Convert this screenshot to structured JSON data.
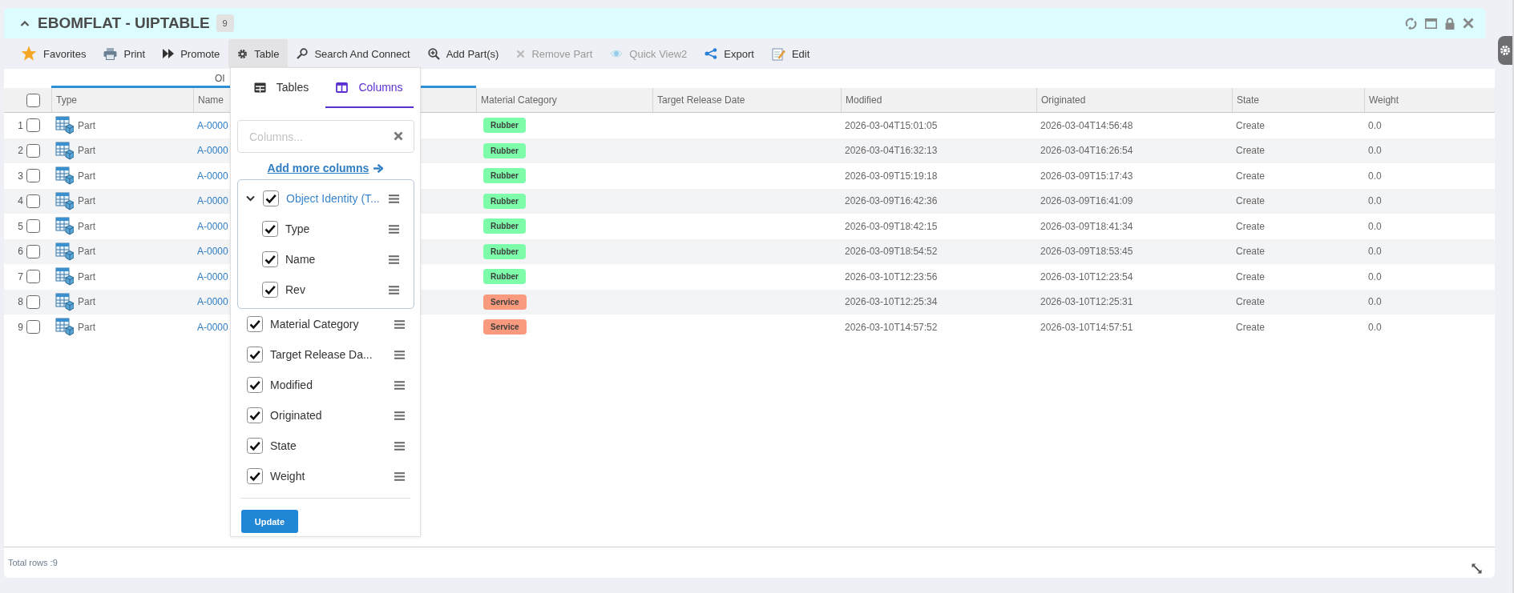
{
  "panel": {
    "title": "EBOMFLAT - UIPTABLE",
    "count": "9",
    "expanded": true
  },
  "toolbar": [
    {
      "label": "Favorites",
      "selected": false,
      "disabled": false
    },
    {
      "label": "Print",
      "selected": false,
      "disabled": false
    },
    {
      "label": "Promote",
      "selected": false,
      "disabled": false
    },
    {
      "label": "Table",
      "selected": true,
      "disabled": false
    },
    {
      "label": "Search And Connect",
      "selected": false,
      "disabled": false
    },
    {
      "label": "Add Part(s)",
      "selected": false,
      "disabled": false
    },
    {
      "label": "Remove Part",
      "selected": false,
      "disabled": true
    },
    {
      "label": "Quick View2",
      "selected": false,
      "disabled": true
    },
    {
      "label": "Export",
      "selected": false,
      "disabled": false
    },
    {
      "label": "Edit",
      "selected": false,
      "disabled": false
    }
  ],
  "table": {
    "group_header": "OI",
    "header_checked": false,
    "columns": [
      "Type",
      "Name",
      "Material Category",
      "Target Release Date",
      "Modified",
      "Originated",
      "State",
      "Weight"
    ],
    "rows": [
      {
        "number": "1",
        "checked": false,
        "type": "Part",
        "name": "A-0000",
        "material_category": {
          "label": "Rubber",
          "color": "#7dfcaa"
        },
        "modified": "2026-03-04T15:01:05",
        "originated": "2026-03-04T14:56:48",
        "state": "Create",
        "weight": "0.0"
      },
      {
        "number": "2",
        "checked": false,
        "type": "Part",
        "name": "A-0000",
        "material_category": {
          "label": "Rubber",
          "color": "#7dfcaa"
        },
        "modified": "2026-03-04T16:32:13",
        "originated": "2026-03-04T16:26:54",
        "state": "Create",
        "weight": "0.0"
      },
      {
        "number": "3",
        "checked": false,
        "type": "Part",
        "name": "A-0000",
        "material_category": {
          "label": "Rubber",
          "color": "#7dfcaa"
        },
        "modified": "2026-03-09T15:19:18",
        "originated": "2026-03-09T15:17:43",
        "state": "Create",
        "weight": "0.0"
      },
      {
        "number": "4",
        "checked": false,
        "type": "Part",
        "name": "A-0000",
        "material_category": {
          "label": "Rubber",
          "color": "#7dfcaa"
        },
        "modified": "2026-03-09T16:42:36",
        "originated": "2026-03-09T16:41:09",
        "state": "Create",
        "weight": "0.0"
      },
      {
        "number": "5",
        "checked": false,
        "type": "Part",
        "name": "A-0000",
        "material_category": {
          "label": "Rubber",
          "color": "#7dfcaa"
        },
        "modified": "2026-03-09T18:42:15",
        "originated": "2026-03-09T18:41:34",
        "state": "Create",
        "weight": "0.0"
      },
      {
        "number": "6",
        "checked": false,
        "type": "Part",
        "name": "A-0000",
        "material_category": {
          "label": "Rubber",
          "color": "#7dfcaa"
        },
        "modified": "2026-03-09T18:54:52",
        "originated": "2026-03-09T18:53:45",
        "state": "Create",
        "weight": "0.0"
      },
      {
        "number": "7",
        "checked": false,
        "type": "Part",
        "name": "A-0000",
        "material_category": {
          "label": "Rubber",
          "color": "#7dfcaa"
        },
        "modified": "2026-03-10T12:23:56",
        "originated": "2026-03-10T12:23:54",
        "state": "Create",
        "weight": "0.0"
      },
      {
        "number": "8",
        "checked": false,
        "type": "Part",
        "name": "A-0000",
        "material_category": {
          "label": "Service",
          "color": "#f99a7f"
        },
        "modified": "2026-03-10T12:25:34",
        "originated": "2026-03-10T12:25:31",
        "state": "Create",
        "weight": "0.0"
      },
      {
        "number": "9",
        "checked": false,
        "type": "Part",
        "name": "A-0000",
        "material_category": {
          "label": "Service",
          "color": "#f99a7f"
        },
        "modified": "2026-03-10T14:57:52",
        "originated": "2026-03-10T14:57:51",
        "state": "Create",
        "weight": "0.0"
      }
    ]
  },
  "column_picker": {
    "tabs": [
      {
        "label": "Tables",
        "selected": false
      },
      {
        "label": "Columns",
        "selected": true
      }
    ],
    "search": {
      "placeholder": "Columns..."
    },
    "add_more_link": "Add more columns",
    "items": [
      {
        "label": "Object Identity (T...",
        "checked": true,
        "expanded": true,
        "children": [
          {
            "label": "Type",
            "checked": true
          },
          {
            "label": "Name",
            "checked": true
          },
          {
            "label": "Rev",
            "checked": true
          }
        ]
      },
      {
        "label": "Material Category",
        "checked": true
      },
      {
        "label": "Target Release Da...",
        "checked": true
      },
      {
        "label": "Modified",
        "checked": true
      },
      {
        "label": "Originated",
        "checked": true
      },
      {
        "label": "State",
        "checked": true
      },
      {
        "label": "Weight",
        "checked": true
      }
    ],
    "update_button": "Update"
  },
  "footer": {
    "total_rows": "Total rows :9"
  }
}
